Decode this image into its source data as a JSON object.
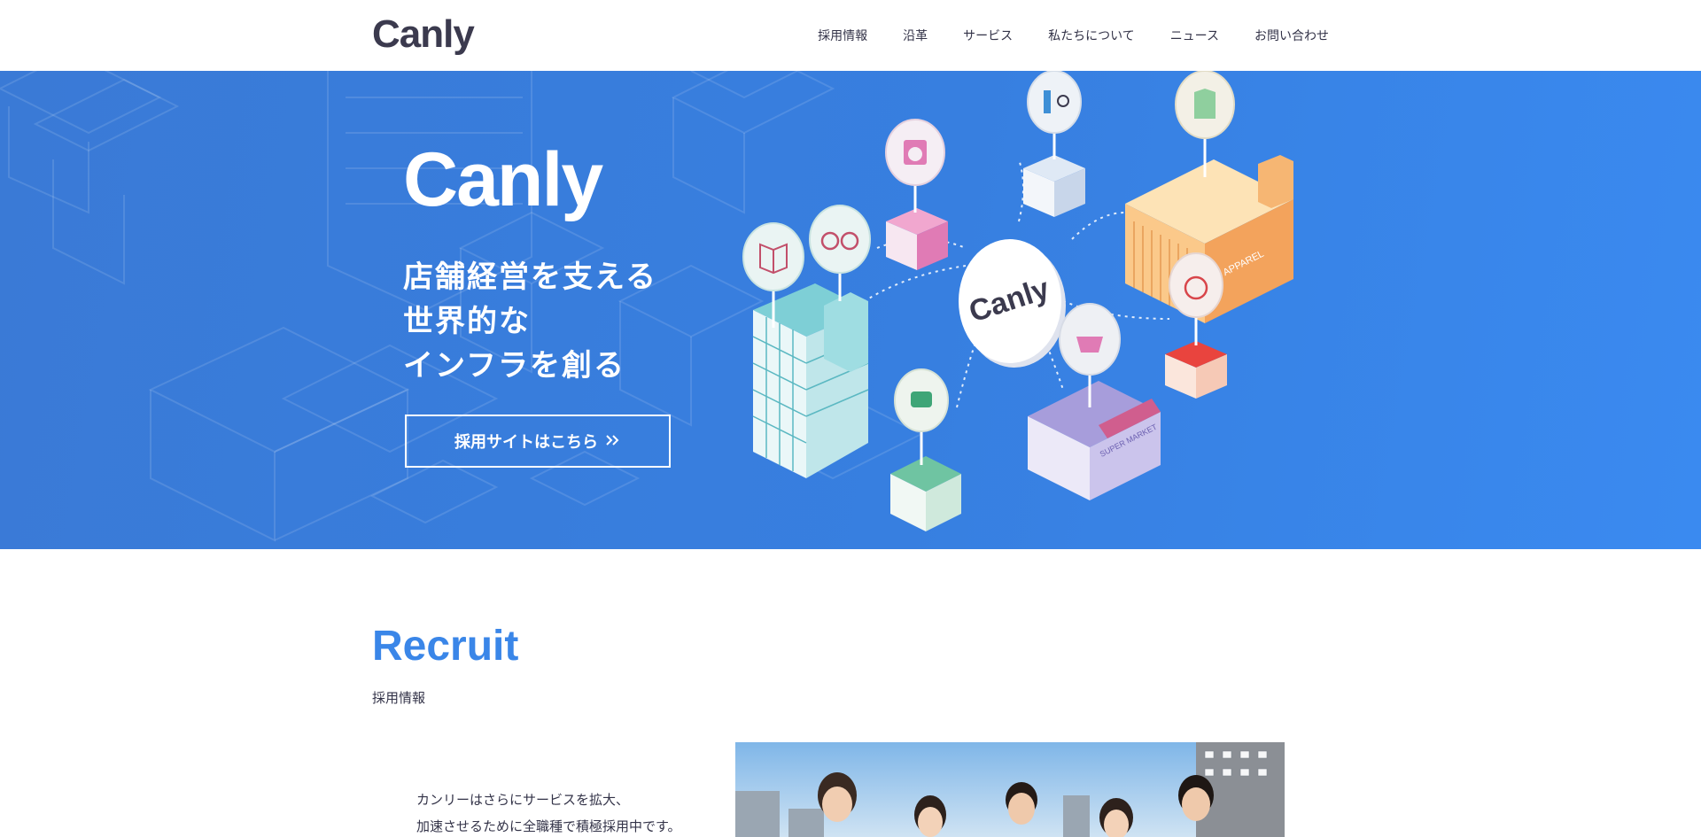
{
  "header": {
    "logo": "Canly",
    "nav": [
      "採用情報",
      "沿革",
      "サービス",
      "私たちについて",
      "ニュース",
      "お問い合わせ"
    ]
  },
  "hero": {
    "logo": "Canly",
    "headline": [
      "店舗経営を支える",
      "世界的な",
      "インフラを創る"
    ],
    "button_label": "採用サイトはこちら",
    "button_icon": "double-chevron-right-icon",
    "hub_label": "Canly",
    "store_labels": [
      "APPAREL",
      "SUPER MARKET"
    ],
    "colors": {
      "background": "#377fe0"
    }
  },
  "recruit": {
    "title": "Recruit",
    "subtitle": "採用情報",
    "lines": [
      "カンリーはさらにサービスを拡大、",
      "加速させるために全職種で積極採用中です。"
    ]
  },
  "colors": {
    "accent": "#3a86e8",
    "text": "#333348"
  }
}
